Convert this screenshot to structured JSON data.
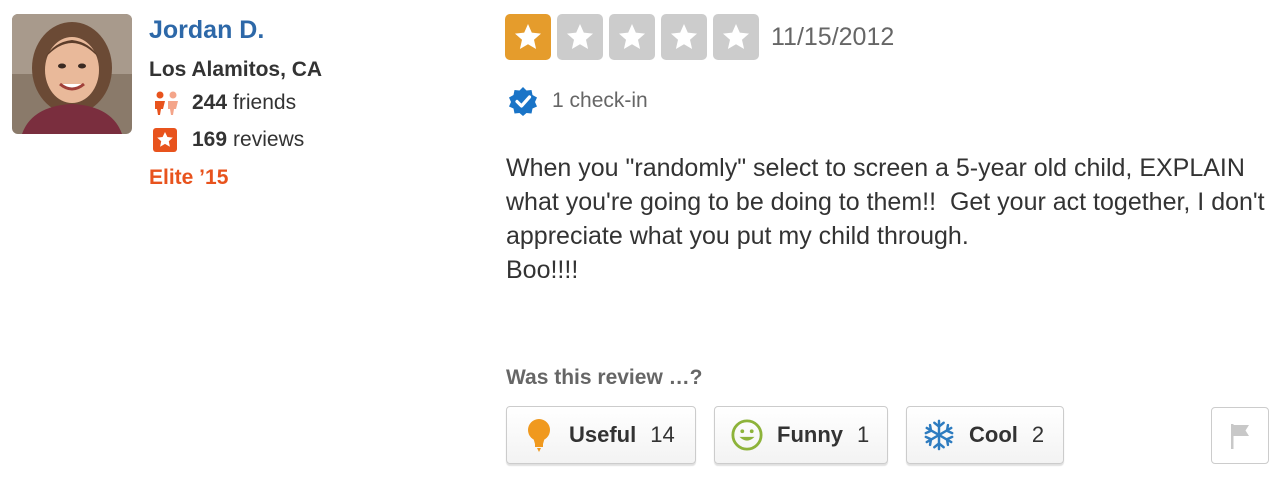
{
  "user": {
    "name": "Jordan D.",
    "location": "Los Alamitos, CA",
    "friends_count": "244",
    "friends_label": "friends",
    "reviews_count": "169",
    "reviews_label": "reviews",
    "elite": "Elite ’15"
  },
  "review": {
    "rating": 1,
    "rating_max": 5,
    "date": "11/15/2012",
    "checkin": "1 check-in",
    "paragraphs": [
      "When you \"randomly\" select to screen a 5-year old child, EXPLAIN what you're going to be doing to them!!  Get your act together, I don't appreciate what you put my child through.",
      "Boo!!!!"
    ]
  },
  "votes": {
    "prompt": "Was this review …?",
    "useful_label": "Useful",
    "useful_count": "14",
    "funny_label": "Funny",
    "funny_count": "1",
    "cool_label": "Cool",
    "cool_count": "2"
  },
  "icons": {
    "avatar": "user-avatar",
    "friends": "friends-icon",
    "reviews": "review-star-icon",
    "star": "star-icon",
    "checkin": "verified-check-icon",
    "useful": "lightbulb-icon",
    "funny": "smiley-icon",
    "cool": "snowflake-icon",
    "flag": "flag-icon"
  },
  "colors": {
    "name": "#2d68a8",
    "elite": "#e8531d",
    "star_on": "#e59c2c",
    "star_off": "#cccccc",
    "checkin_badge": "#1a74c7"
  }
}
